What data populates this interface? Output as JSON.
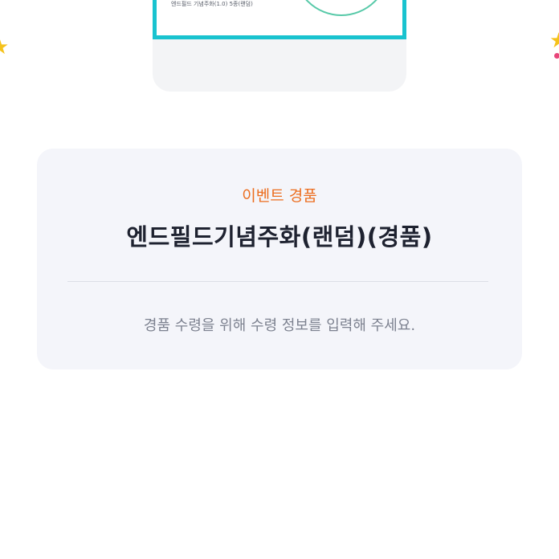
{
  "prize_image": {
    "caption": "엔드필드 기념주화(1.0) 5종(랜덤)"
  },
  "decorations": {
    "left_icon": "star-icon",
    "right_icon": "star-icon",
    "accent_color": "#19c3cf"
  },
  "event": {
    "label": "이벤트 경품",
    "prize_name": "엔드필드기념주화(랜덤)(경품)",
    "instruction": "경품 수령을 위해 수령 정보를 입력해 주세요."
  },
  "colors": {
    "event_label": "#ec6d1e",
    "title": "#1e2230",
    "instruction": "#7d8290",
    "card_bg": "#f4f5fa"
  }
}
